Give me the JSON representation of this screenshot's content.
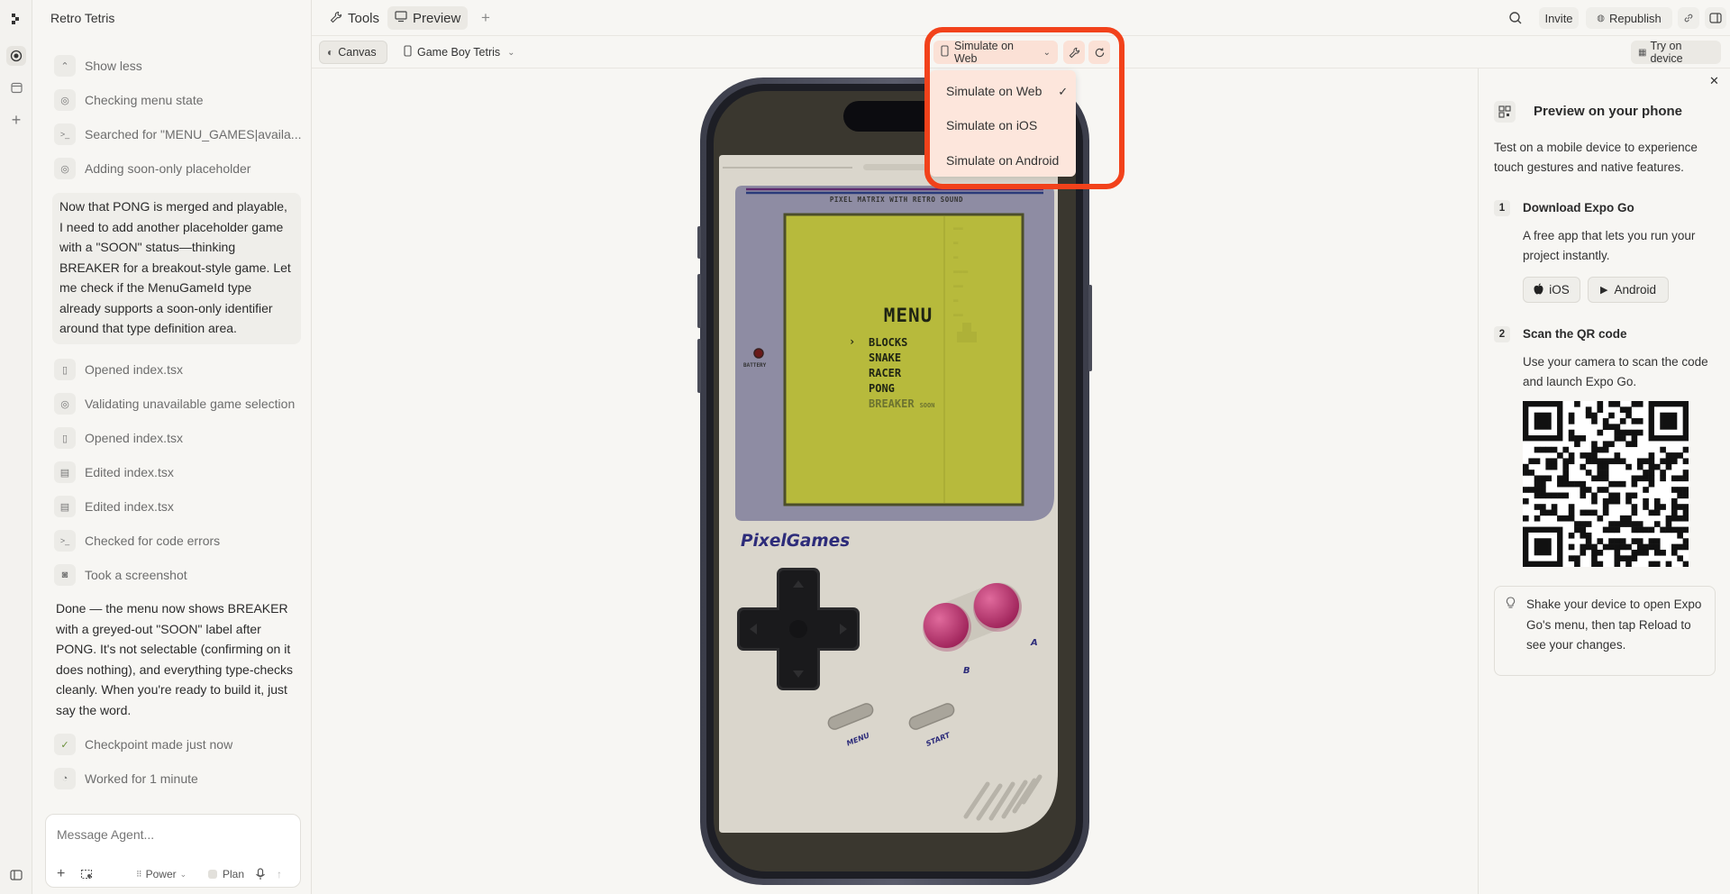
{
  "project": {
    "title": "Retro Tetris"
  },
  "chat": {
    "steps_top": [
      {
        "icon": "chevron-up-icon",
        "glyph": "⌃",
        "label": "Show less"
      },
      {
        "icon": "brain-icon",
        "glyph": "◎",
        "label": "Checking menu state"
      },
      {
        "icon": "terminal-icon",
        "glyph": ">_",
        "label": "Searched for \"MENU_GAMES|availa..."
      },
      {
        "icon": "brain-icon",
        "glyph": "◎",
        "label": "Adding soon-only placeholder"
      }
    ],
    "message1": "Now that PONG is merged and playable, I need to add another placeholder game with a \"SOON\" status—thinking BREAKER for a breakout-style game. Let me check if the MenuGameId type already supports a soon-only identifier around that type definition area.",
    "steps_mid": [
      {
        "icon": "book-icon",
        "glyph": "▯",
        "label": "Opened index.tsx"
      },
      {
        "icon": "brain-icon",
        "glyph": "◎",
        "label": "Validating unavailable game selection"
      },
      {
        "icon": "book-icon",
        "glyph": "▯",
        "label": "Opened index.tsx"
      },
      {
        "icon": "file-edit-icon",
        "glyph": "▤",
        "label": "Edited index.tsx"
      },
      {
        "icon": "file-edit-icon",
        "glyph": "▤",
        "label": "Edited index.tsx"
      },
      {
        "icon": "terminal-icon",
        "glyph": ">_",
        "label": "Checked for code errors"
      },
      {
        "icon": "camera-icon",
        "glyph": "◙",
        "label": "Took a screenshot"
      }
    ],
    "message2": "Done — the menu now shows BREAKER with a greyed-out \"SOON\" label after PONG. It's not selectable (confirming on it does nothing), and everything type-checks cleanly. When you're ready to build it, just say the word.",
    "steps_bottom": [
      {
        "icon": "check-circle-icon",
        "glyph": "✓",
        "label": "Checkpoint made just now"
      },
      {
        "icon": "timer-icon",
        "glyph": "◔",
        "label": "Worked for 1 minute"
      }
    ],
    "composer": {
      "placeholder": "Message Agent...",
      "mode": "Power",
      "plan": "Plan"
    }
  },
  "topbar": {
    "tabs": [
      {
        "label": "Tools"
      },
      {
        "label": "Preview"
      }
    ],
    "invite": "Invite",
    "republish": "Republish"
  },
  "subbar": {
    "canvas": "Canvas",
    "device": "Game Boy Tetris",
    "simulate": "Simulate on Web",
    "try_device": "Try on device"
  },
  "dropdown": {
    "items": [
      "Simulate on Web",
      "Simulate on iOS",
      "Simulate on Android"
    ],
    "selected": "Simulate on Web"
  },
  "gameboy": {
    "banner": "PIXEL MATRIX WITH RETRO SOUND",
    "battery": "BATTERY",
    "menu_title": "MENU",
    "games": [
      "BLOCKS",
      "SNAKE",
      "RACER",
      "PONG",
      "BREAKER"
    ],
    "soon": "SOON",
    "brand": "PixelGames",
    "btn_a": "A",
    "btn_b": "B",
    "btn_menu": "MENU",
    "btn_start": "START"
  },
  "right_panel": {
    "title": "Preview on your phone",
    "intro": "Test on a mobile device to experience touch gestures and native features.",
    "step1_num": "1",
    "step1_title": "Download Expo Go",
    "step1_desc": "A free app that lets you run your project instantly.",
    "ios": "iOS",
    "android": "Android",
    "step2_num": "2",
    "step2_title": "Scan the QR code",
    "step2_desc": "Use your camera to scan the code and launch Expo Go.",
    "tip": "Shake your device to open Expo Go's menu, then tap Reload to see your changes."
  },
  "colors": {
    "highlight": "#f2421b",
    "lcd": "#b7ba3c",
    "shell": "#dad6cc",
    "button_ab": "#b8336a"
  }
}
